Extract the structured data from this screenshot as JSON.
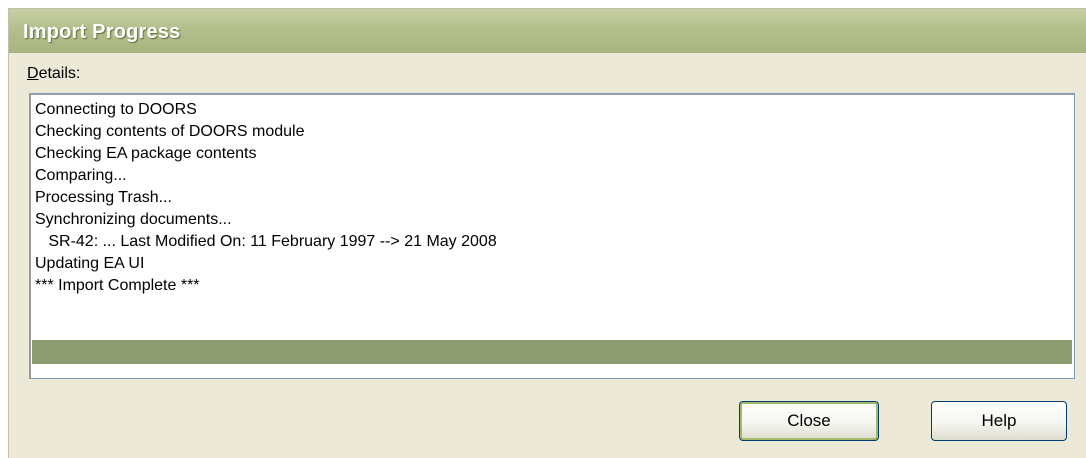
{
  "window": {
    "title": "Import Progress"
  },
  "details": {
    "label_accel": "D",
    "label_rest": "etails:"
  },
  "log": {
    "lines": [
      "Connecting to DOORS",
      "Checking contents of DOORS module",
      "Checking EA package contents",
      "Comparing...",
      "Processing Trash...",
      "Synchronizing documents...",
      "   SR-42: ... Last Modified On: 11 February 1997 --> 21 May 2008",
      "Updating EA UI",
      "*** Import Complete ***"
    ],
    "selected_index": 9
  },
  "buttons": {
    "close_label": "Close",
    "help_label": "Help"
  },
  "colors": {
    "titlebar": "#b3bf8c",
    "selection": "#8f9c6f",
    "dialog_bg": "#ece9d8"
  }
}
